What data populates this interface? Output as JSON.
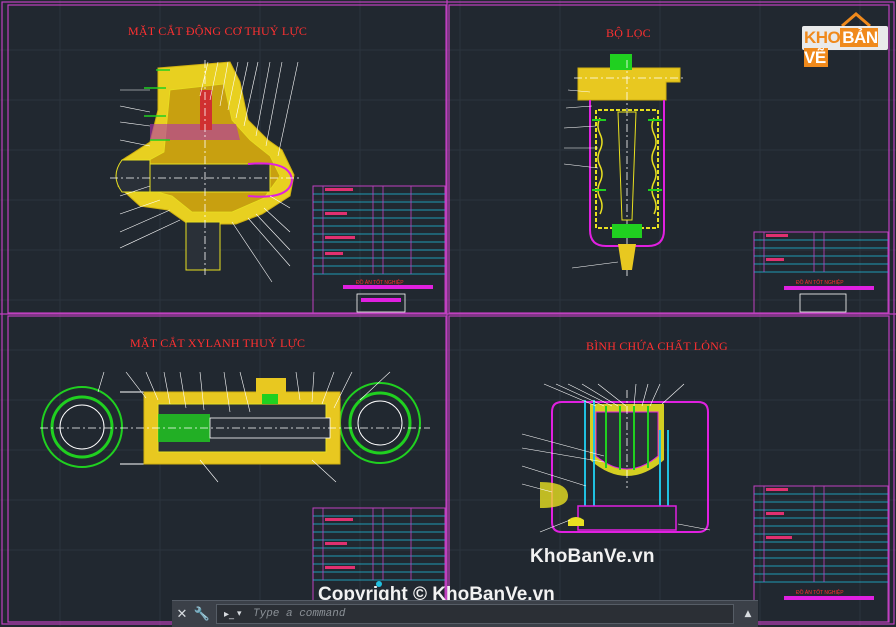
{
  "drawing": {
    "sections": [
      {
        "title": "MẶT CẮT ĐỘNG CƠ THUỶ LỰC"
      },
      {
        "title": "BỘ LỌC"
      },
      {
        "title": "MẶT CẮT XYLANH THUỶ LỰC"
      },
      {
        "title": "BÌNH CHỨA CHẤT LỎNG"
      }
    ],
    "title_block_label": "ĐỒ ÁN TỐT NGHIỆP"
  },
  "watermark": {
    "logo_part1": "KHO",
    "logo_part2": "BẢN VẼ",
    "site": "KhoBanVe.vn",
    "copyright": "Copyright © KhoBanVe.vn"
  },
  "command_line": {
    "placeholder": "Type a command",
    "close_icon": "close-icon",
    "settings_icon": "wrench-icon",
    "prompt_icon": "command-prompt-icon"
  },
  "colors": {
    "background": "#212830",
    "frame": "#c040c0",
    "yellow": "#e8e020",
    "green": "#20d020",
    "cyan": "#20c0e0",
    "red": "#ff3030",
    "magenta": "#e020e0"
  }
}
